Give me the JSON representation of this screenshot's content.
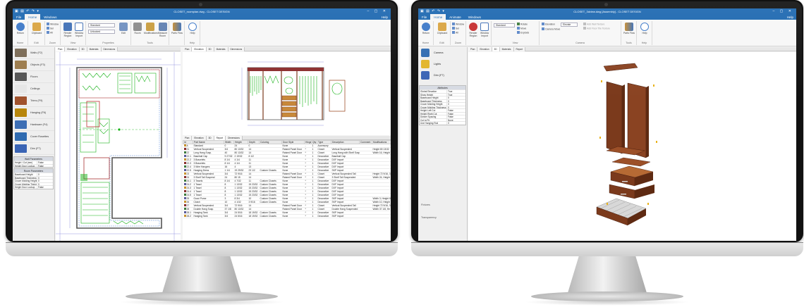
{
  "left": {
    "window_title": "CLOSET_roomplan.dwg - CLOSET DESIGN",
    "menu": [
      "File",
      "Home",
      "Windows"
    ],
    "active_menu": "Home",
    "help": "Help",
    "ribbon": {
      "groups": [
        "Home",
        "Edit",
        "Zoom",
        "View",
        "Properties",
        "Tools",
        "Help"
      ],
      "buttons": [
        "Return",
        "Clipboard",
        "Render Region",
        "Window Import",
        "Edit",
        "Room",
        "Modifications",
        "Measure Room",
        "Parts Flow",
        "Help"
      ],
      "small": [
        "Window",
        "Sel",
        "All"
      ],
      "dropdowns": [
        "Standard",
        "Unlocked"
      ]
    },
    "library": [
      {
        "label": "Walls (F2)",
        "color": "#7a6a55"
      },
      {
        "label": "Objects (F3)",
        "color": "#9b7b4b"
      },
      {
        "label": "Floors",
        "color": "#555555"
      },
      {
        "label": "Ceilings",
        "color": "#e6e6e6"
      },
      {
        "label": "Trims (F9)",
        "color": "#a0522d"
      },
      {
        "label": "Hanging (F6)",
        "color": "#b8860b"
      },
      {
        "label": "Hardware (F4)",
        "color": "#3e6fb5"
      },
      {
        "label": "Cover Rosettes",
        "color": "#2f6bb1"
      },
      {
        "label": "Dim (F7)",
        "color": "#3a64b5"
      }
    ],
    "wall_params": {
      "title": "Wall Parameters",
      "rows": [
        [
          "Height / Cut (mm)",
          "False"
        ],
        [
          "Height Door Lookup",
          "False"
        ]
      ]
    },
    "room_params": {
      "title": "Room Parameters",
      "rows": [
        [
          "Baseboard Height",
          "0"
        ],
        [
          "Baseboard Thickness",
          "0"
        ],
        [
          "Crown Molding Height",
          "0"
        ],
        [
          "Crown Molding Thickness",
          "0"
        ],
        [
          "Height Door Lookup",
          "False"
        ]
      ]
    },
    "tabs_plan": [
      "Plan",
      "Elevation",
      "3D",
      "Materials",
      "Dimensions"
    ],
    "tabs_elev": [
      "Plan",
      "Elevation",
      "3D",
      "Materials",
      "Dimensions"
    ],
    "tabs_report": [
      "Plan",
      "Elevation",
      "3D",
      "Report",
      "Dimensions"
    ],
    "table": {
      "headers": [
        "Id",
        "Part Name",
        "Width",
        "Height",
        "Depth",
        "Coloring",
        "Door Style",
        "Hinge",
        "Qty",
        "Type",
        "Description",
        "Comment",
        "Modifications"
      ],
      "rows": [
        [
          "A",
          "Standard",
          "0",
          "24",
          "0",
          "",
          "None",
          "-",
          "1",
          "Accessory",
          "",
          "",
          ""
        ],
        [
          "21",
          "Vertical Suspended",
          "3/4",
          "80 13/32",
          "14",
          "",
          "Raised Panel Door",
          "*",
          "1",
          "Closet",
          "Vertical Suspended",
          "",
          "Height 80 13/32"
        ],
        [
          "22",
          "Long Hang Susp.",
          "40",
          "80 13/32",
          "14",
          "",
          "Raised Panel Door",
          "*",
          "1",
          "Closet",
          "Long Hang with Shelf Suspended",
          "",
          "Width 16, Height"
        ],
        [
          "22.1",
          "Baseball Cap",
          "9 27/32",
          "2 19/32",
          "8 1/2",
          "",
          "None",
          "*",
          "1",
          "Decorative",
          "Baseball Cap",
          "",
          ""
        ],
        [
          "22.2",
          "3 Bracelets",
          "8 1/4",
          "4 1/4",
          "11",
          "",
          "None",
          "*",
          "1",
          "Decorative",
          "DXF Import",
          "",
          ""
        ],
        [
          "22.3",
          "3 Bracelets",
          "8 1/4",
          "4 1/4",
          "11",
          "",
          "None",
          "*",
          "1",
          "Decorative",
          "DXF Import",
          "",
          ""
        ],
        [
          "22.4",
          "3 Wire Hangers",
          "16",
          "4",
          "13",
          "",
          "None",
          "*",
          "1",
          "Decorative",
          "DXF Import",
          "",
          ""
        ],
        [
          "22.5",
          "Hanging Dress",
          "1 1/4",
          "19 29/32",
          "23 1/2",
          "Custom Closets",
          "None",
          "*",
          "1",
          "Decorative",
          "SKP Import",
          "",
          ""
        ],
        [
          "23",
          "Vertical Suspended",
          "3/4",
          "72 9/16",
          "14",
          "",
          "Raised Panel Door",
          "*",
          "1",
          "Closet",
          "Vertical Suspended Tall",
          "",
          "Height 72 9/16, 3"
        ],
        [
          "24",
          "3 Shelf Tall Suspend",
          "24",
          "80 15",
          "14",
          "",
          "Raised Panel Door",
          "*",
          "1",
          "Closet",
          "3 Shelf Tall Suspended",
          "",
          "Width 24, Height"
        ],
        [
          "24.1",
          "3 Towels",
          "8 1/4",
          "4 7/32",
          "11",
          "Custom Closets",
          "None",
          "*",
          "1",
          "Decorative",
          "DXF Import",
          "",
          ""
        ],
        [
          "24.2",
          "1 Towel",
          "8",
          "1 13/32",
          "15 23/32",
          "Custom Closets",
          "None",
          "*",
          "1",
          "Decorative",
          "DXF Import",
          "",
          ""
        ],
        [
          "24.3",
          "1 Towel",
          "8",
          "1 13/32",
          "15 23/32",
          "Custom Closets",
          "None",
          "*",
          "1",
          "Decorative",
          "DXF Import",
          "",
          ""
        ],
        [
          "24.4",
          "1 Towel",
          "8",
          "1 13/32",
          "15 23/32",
          "Custom Closets",
          "None",
          "*",
          "1",
          "Decorative",
          "DXF Import",
          "",
          ""
        ],
        [
          "24.5",
          "1 Towel",
          "8",
          "1 13/32",
          "15 23/32",
          "Custom Closets",
          "None",
          "*",
          "1",
          "Decorative",
          "DXF Import",
          "",
          ""
        ],
        [
          "25",
          "Gucci Purse",
          "3",
          "8 3/4",
          "10",
          "Custom Closets",
          "None",
          "*",
          "1",
          "Decorative",
          "SKP Import",
          "",
          "Width 3, Height 8"
        ],
        [
          "26",
          "Clutch",
          "10",
          "4 1/32",
          "3 9/16",
          "Custom Closets",
          "None",
          "*",
          "1",
          "Decorative",
          "SKP Import",
          "",
          "Width 10, Height"
        ],
        [
          "27",
          "Vertical Suspended",
          "3/4",
          "72 9/16",
          "14",
          "",
          "Raised Panel Door",
          "*",
          "1",
          "Closet",
          "Vertical Suspended Tall",
          "",
          "Height 72 9/16, 3"
        ],
        [
          "28",
          "Double Hang Susp.",
          "37 1/8",
          "80 13/32",
          "14",
          "",
          "Raised Panel Door",
          "*",
          "1",
          "Closet",
          "Double Hang Suspended",
          "",
          "Width 37 1/8, He"
        ],
        [
          "28.1",
          "Hanging Tank",
          "3/4",
          "24 5/16",
          "18 19/32",
          "Custom Closets",
          "None",
          "*",
          "1",
          "Decorative",
          "SKP Import",
          "",
          ""
        ],
        [
          "28.2",
          "Hanging Tank",
          "3/4",
          "24 5/16",
          "18 19/32",
          "Custom Closets",
          "None",
          "*",
          "1",
          "Decorative",
          "SKP Import",
          "",
          ""
        ]
      ],
      "swatch_colors": [
        "#c8922d",
        "#8b2e2e",
        "#3b7a3b",
        "#5b5b9b"
      ]
    }
  },
  "right": {
    "window_title": "CLOSET_3dview.dwg [Assembly] - CLOSET DESIGN",
    "menu": [
      "File",
      "Home",
      "Animate",
      "Windows"
    ],
    "active_menu": "Home",
    "help": "Help",
    "ribbon": {
      "groups": [
        "Home",
        "Edit",
        "Zoom",
        "View",
        "Camera",
        "Tools",
        "Help"
      ],
      "buttons": [
        "Return",
        "Clipboard",
        "Render Region",
        "Window Import",
        "Parts Flow",
        "Help"
      ],
      "small": [
        "Window",
        "Sel",
        "All",
        "Rotate",
        "Move",
        "Explode",
        "Elevation",
        "Camera Move",
        "Add Wall Texture",
        "Add Floor Tile Texture"
      ],
      "dropdowns": [
        "Standard",
        "Elevate"
      ]
    },
    "library": [
      {
        "label": "Camera",
        "color": "#2f6bb1"
      },
      {
        "label": "Lights",
        "color": "#e2b52a"
      },
      {
        "label": "Dim (F7)",
        "color": "#3a64b5"
      }
    ],
    "attributes": {
      "title": "Attributes",
      "rows": [
        [
          "Global Elevation",
          "True"
        ],
        [
          "Show Height",
          "True"
        ],
        [
          "Baseboard Height",
          "0"
        ],
        [
          "Baseboard Thickness",
          "0"
        ],
        [
          "Crown Molding Height",
          "0"
        ],
        [
          "Crown Molding Thickness",
          "0"
        ],
        [
          "Height Left Cut",
          "False"
        ],
        [
          "Height Right Cut",
          "False"
        ],
        [
          "Divider Spacing",
          "False"
        ],
        [
          "Cut to Fit",
          "None"
        ],
        [
          "Use Hanging Rod",
          "0"
        ]
      ]
    },
    "bottom_labels": [
      "Fixtures",
      "Transparency"
    ],
    "tabs_3d": [
      "Plan",
      "Elevation",
      "3D",
      "Materials",
      "Report"
    ],
    "wood_color": "#7b3a1c"
  }
}
